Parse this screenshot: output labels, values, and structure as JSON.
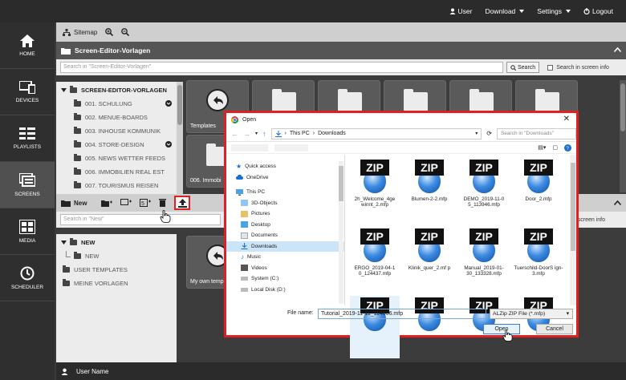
{
  "topbar": {
    "user_label": "User",
    "download_label": "Download",
    "settings_label": "Settings",
    "logout_label": "Logout"
  },
  "sidebar": {
    "items": [
      {
        "label": "HOME",
        "icon": "home-icon"
      },
      {
        "label": "DEVICES",
        "icon": "devices-icon"
      },
      {
        "label": "PLAYLISTS",
        "icon": "playlists-icon"
      },
      {
        "label": "SCREENS",
        "icon": "screens-icon"
      },
      {
        "label": "MEDIA",
        "icon": "media-icon"
      },
      {
        "label": "SCHEDULER",
        "icon": "scheduler-icon"
      }
    ]
  },
  "sitemap": {
    "label": "Sitemap"
  },
  "panel1": {
    "title": "Screen-Editor-Vorlagen",
    "search_placeholder": "Search in \"Screen-Editor-Vorlagen\"",
    "search_button": "Search",
    "search_in_screen_info": "Search in screen info",
    "tree_root": "SCREEN-EDITOR-VORLAGEN",
    "tree_items": [
      "001. SCHULUNG",
      "002. MENUE-BOARDS",
      "003. INHOUSE KOMMUNIK",
      "004. STORE-DESIGN",
      "005. NEWS WETTER FEEDS",
      "006. IMMOBILIEN REAL EST",
      "007. TOURISMUS REISEN"
    ],
    "tile_labels": [
      "Templates",
      "006. Immobi"
    ]
  },
  "panel2": {
    "title": "New",
    "search_placeholder": "Search in \"New\"",
    "search_in_screen_info": "Search in screen info",
    "tree_items": [
      "NEW",
      "NEW",
      "USER TEMPLATES",
      "MEINE VORLAGEN"
    ],
    "tile_label": "My own templ"
  },
  "userbar": {
    "label": "User Name"
  },
  "dialog": {
    "title": "Open",
    "breadcrumb": [
      "This PC",
      "Downloads"
    ],
    "search_placeholder": "Search in \"Downloads\"",
    "nav": [
      {
        "label": "Quick access",
        "icon": "star-icon"
      },
      {
        "label": "OneDrive",
        "icon": "cloud-icon"
      },
      {
        "label": "This PC",
        "icon": "pc-icon"
      },
      {
        "label": "3D-Objects",
        "icon": "cube-icon"
      },
      {
        "label": "Pictures",
        "icon": "pictures-icon"
      },
      {
        "label": "Desktop",
        "icon": "desktop-icon"
      },
      {
        "label": "Documents",
        "icon": "documents-icon"
      },
      {
        "label": "Downloads",
        "icon": "downloads-icon",
        "selected": true
      },
      {
        "label": "Music",
        "icon": "music-icon"
      },
      {
        "label": "Videos",
        "icon": "videos-icon"
      },
      {
        "label": "System (C:)",
        "icon": "drive-icon"
      },
      {
        "label": "Local Disk  (D:)",
        "icon": "drive-icon"
      }
    ],
    "files": [
      {
        "name": "2h_Welcome_4ge winnt_2.mfp"
      },
      {
        "name": "Blumen-2-2.mfp"
      },
      {
        "name": "DEMO_2019-11-0 5_113946.mfp"
      },
      {
        "name": "Door_2.mfp"
      },
      {
        "name": "ERGO_2019-04-1 0_124437.mfp"
      },
      {
        "name": "Klinik_quer_2.mf p"
      },
      {
        "name": "Manual_2019-01- 30_133328.mfp"
      },
      {
        "name": "Tuerschild-DoorS ign-3.mfp"
      },
      {
        "name": ""
      },
      {
        "name": ""
      },
      {
        "name": ""
      },
      {
        "name": ""
      }
    ],
    "zip_text": "ZIP",
    "file_name_label": "File name:",
    "file_name_value": "Tutorial_2019-11-11_114606.mfp",
    "file_type": "ALZip ZIP File (*.mfp)",
    "open_button": "Open",
    "cancel_button": "Cancel"
  },
  "colors": {
    "highlight": "#e02020",
    "accent_blue": "#3c7fd0"
  }
}
